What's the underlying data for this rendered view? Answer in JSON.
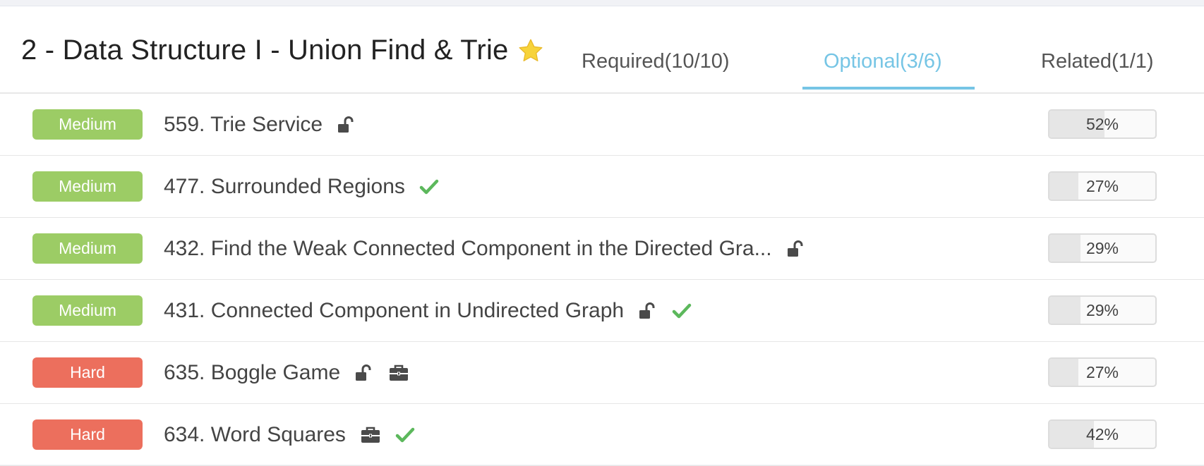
{
  "header": {
    "title": "2 - Data Structure I - Union Find & Trie",
    "tabs": [
      {
        "label": "Required(10/10)",
        "active": false
      },
      {
        "label": "Optional(3/6)",
        "active": true
      },
      {
        "label": "Related(1/1)",
        "active": false
      }
    ]
  },
  "colors": {
    "accent": "#76c5e5",
    "medium": "#9ccc65",
    "hard": "#ec6f5d",
    "check": "#5cb85c",
    "star": "#f7d33a"
  },
  "problems": [
    {
      "difficulty": "Medium",
      "title": "559. Trie Service",
      "icons": [
        "unlock-icon"
      ],
      "progress": "52%"
    },
    {
      "difficulty": "Medium",
      "title": "477. Surrounded Regions",
      "icons": [
        "check-icon"
      ],
      "progress": "27%"
    },
    {
      "difficulty": "Medium",
      "title": "432. Find the Weak Connected Component in the Directed Gra...",
      "icons": [
        "unlock-icon"
      ],
      "progress": "29%"
    },
    {
      "difficulty": "Medium",
      "title": "431. Connected Component in Undirected Graph",
      "icons": [
        "unlock-icon",
        "check-icon"
      ],
      "progress": "29%"
    },
    {
      "difficulty": "Hard",
      "title": "635. Boggle Game",
      "icons": [
        "unlock-icon",
        "briefcase-icon"
      ],
      "progress": "27%"
    },
    {
      "difficulty": "Hard",
      "title": "634. Word Squares",
      "icons": [
        "briefcase-icon",
        "check-icon"
      ],
      "progress": "42%"
    }
  ]
}
